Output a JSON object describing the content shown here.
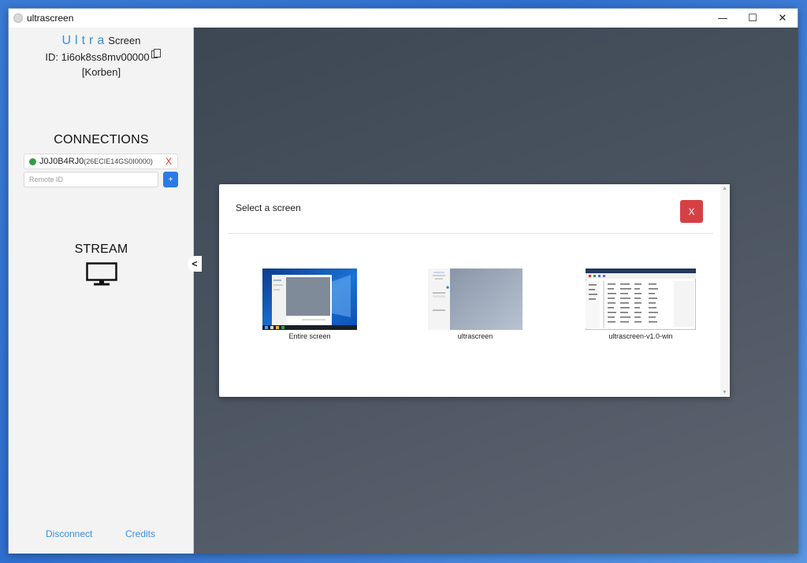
{
  "window": {
    "title": "ultrascreen",
    "minimize": "—",
    "maximize": "☐",
    "close": "✕"
  },
  "sidebar": {
    "brand_ultra": "Ultra",
    "brand_screen": "Screen",
    "id_line": "ID: 1i6ok8ss8mv00000",
    "user": "[Korben]",
    "connections_title": "CONNECTIONS",
    "connections": [
      {
        "id": "J0J0B4RJ0",
        "secondary": "(26ECIE14GS0I0000)",
        "remove": "X"
      }
    ],
    "remote_placeholder": "Remote ID",
    "add_label": "+",
    "stream_title": "STREAM",
    "collapse": "<",
    "disconnect": "Disconnect",
    "credits": "Credits"
  },
  "modal": {
    "title": "Select a screen",
    "close": "X",
    "sources": [
      {
        "label": "Entire screen"
      },
      {
        "label": "ultrascreen"
      },
      {
        "label": "ultrascreen-v1.0-win"
      }
    ]
  },
  "colors": {
    "accent": "#3a8ed6",
    "add_button": "#2c7be5",
    "close_button": "#d64045",
    "status_online": "#3a9a48"
  }
}
